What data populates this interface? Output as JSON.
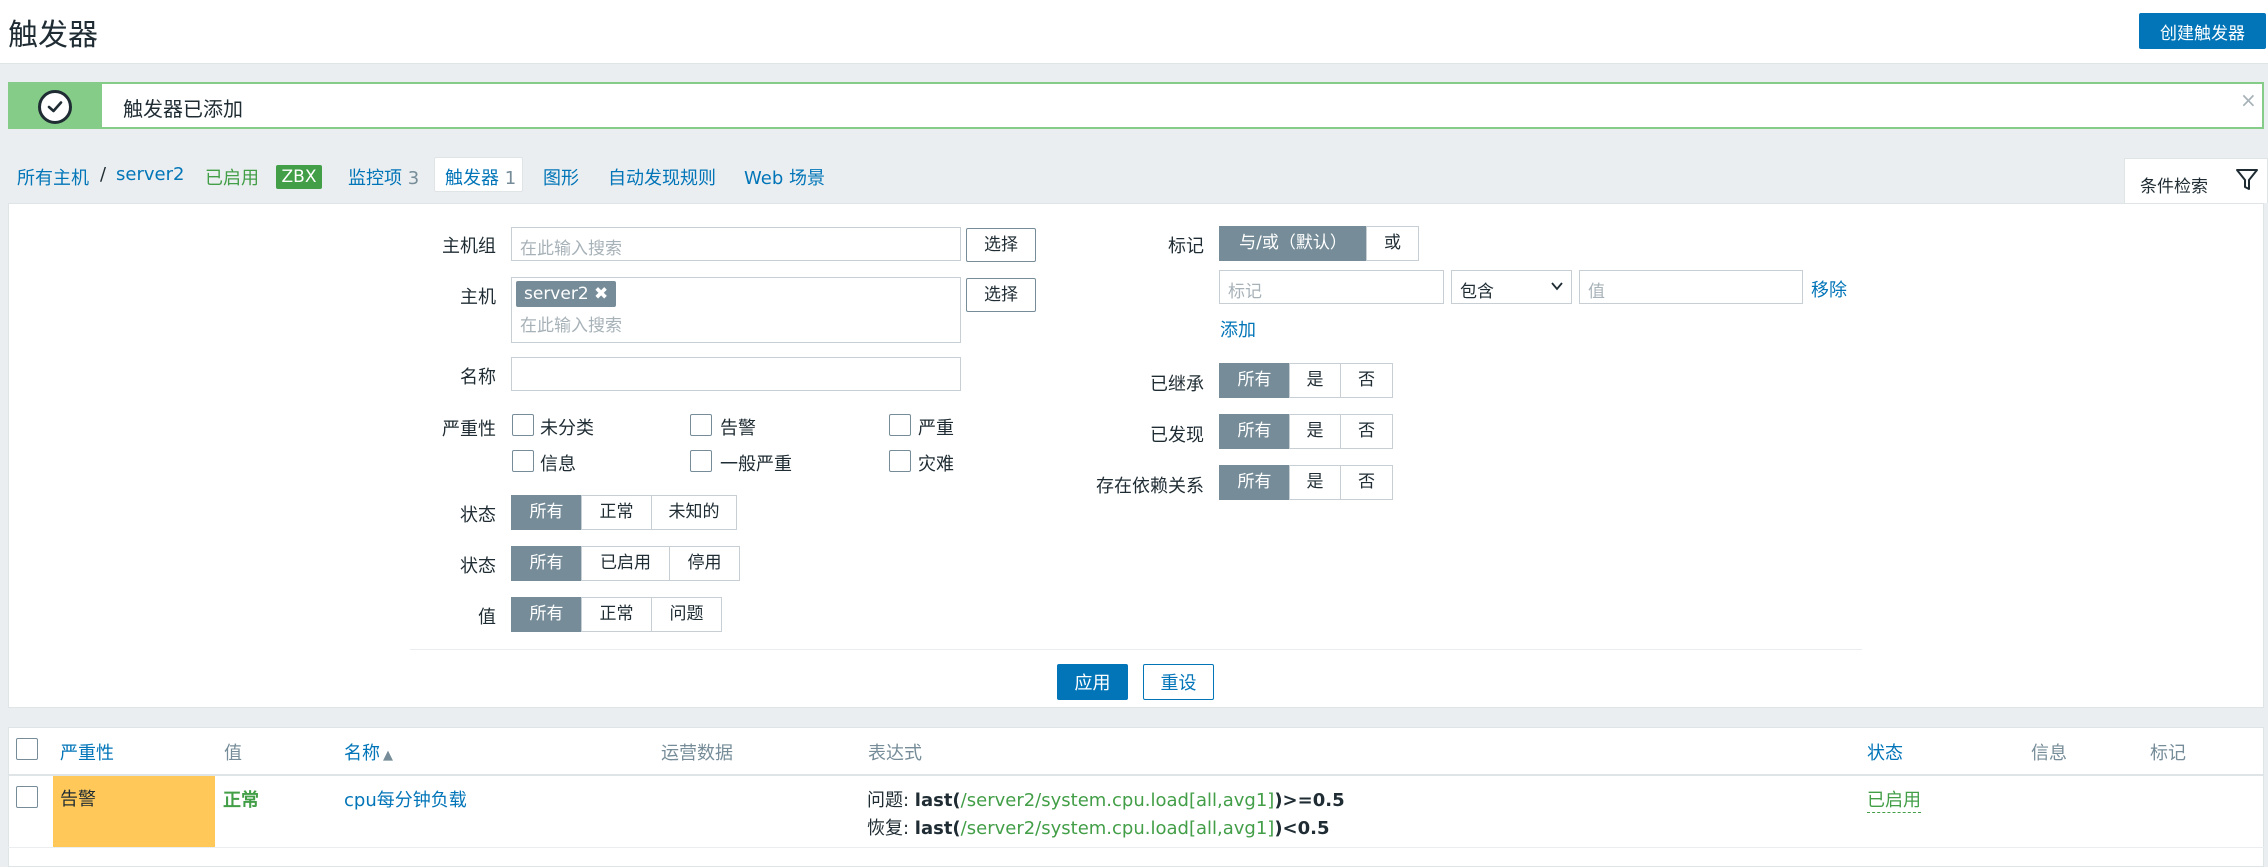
{
  "header": {
    "title": "触发器",
    "create_button": "创建触发器"
  },
  "message": {
    "text": "触发器已添加",
    "close": "×"
  },
  "nav": {
    "all_hosts": "所有主机",
    "separator": "/",
    "host": "server2",
    "enabled": "已启用",
    "zbx": "ZBX",
    "items_label": "监控项",
    "items_count": "3",
    "triggers_label": "触发器",
    "triggers_count": "1",
    "graphs": "图形",
    "discovery": "自动发现规则",
    "web": "Web 场景"
  },
  "filter_tab": {
    "label": "条件检索"
  },
  "filter": {
    "host_groups_label": "主机组",
    "host_groups_placeholder": "在此输入搜索",
    "select_label": "选择",
    "hosts_label": "主机",
    "host_chip": "server2",
    "hosts_placeholder": "在此输入搜索",
    "name_label": "名称",
    "name_value": "",
    "severity_label": "严重性",
    "severities": [
      "未分类",
      "告警",
      "严重",
      "信息",
      "一般严重",
      "灾难"
    ],
    "state_label": "状态",
    "state_options": [
      "所有",
      "正常",
      "未知的"
    ],
    "status_label": "状态",
    "status_options": [
      "所有",
      "已启用",
      "停用"
    ],
    "value_label": "值",
    "value_options": [
      "所有",
      "正常",
      "问题"
    ],
    "tags_label": "标记",
    "tags_mode_options": [
      "与/或（默认）",
      "或"
    ],
    "tag_placeholder": "标记",
    "tag_operator": "包含",
    "tag_value_placeholder": "值",
    "remove_link": "移除",
    "add_link": "添加",
    "inherited_label": "已继承",
    "inherited_options": [
      "所有",
      "是",
      "否"
    ],
    "discovered_label": "已发现",
    "discovered_options": [
      "所有",
      "是",
      "否"
    ],
    "dependencies_label": "存在依赖关系",
    "dependencies_options": [
      "所有",
      "是",
      "否"
    ],
    "apply": "应用",
    "reset": "重设"
  },
  "table": {
    "headers": {
      "severity": "严重性",
      "value": "值",
      "name": "名称",
      "sort_indicator": "▲",
      "operational_data": "运营数据",
      "expression": "表达式",
      "status": "状态",
      "info": "信息",
      "tags": "标记"
    },
    "rows": [
      {
        "severity": "告警",
        "value": "正常",
        "name": "cpu每分钟负载",
        "problem_prefix": "问题: ",
        "problem_func": "last(",
        "problem_item": "/server2/system.cpu.load[all,avg1]",
        "problem_suffix": ")>=0.5",
        "recovery_prefix": "恢复: ",
        "recovery_func": "last(",
        "recovery_item": "/server2/system.cpu.load[all,avg1]",
        "recovery_suffix": ")<0.5",
        "status": "已启用"
      }
    ]
  },
  "colors": {
    "accent": "#0275b8",
    "success": "#86cc89",
    "warning_severity": "#ffc859",
    "ok_green": "#429e47"
  }
}
